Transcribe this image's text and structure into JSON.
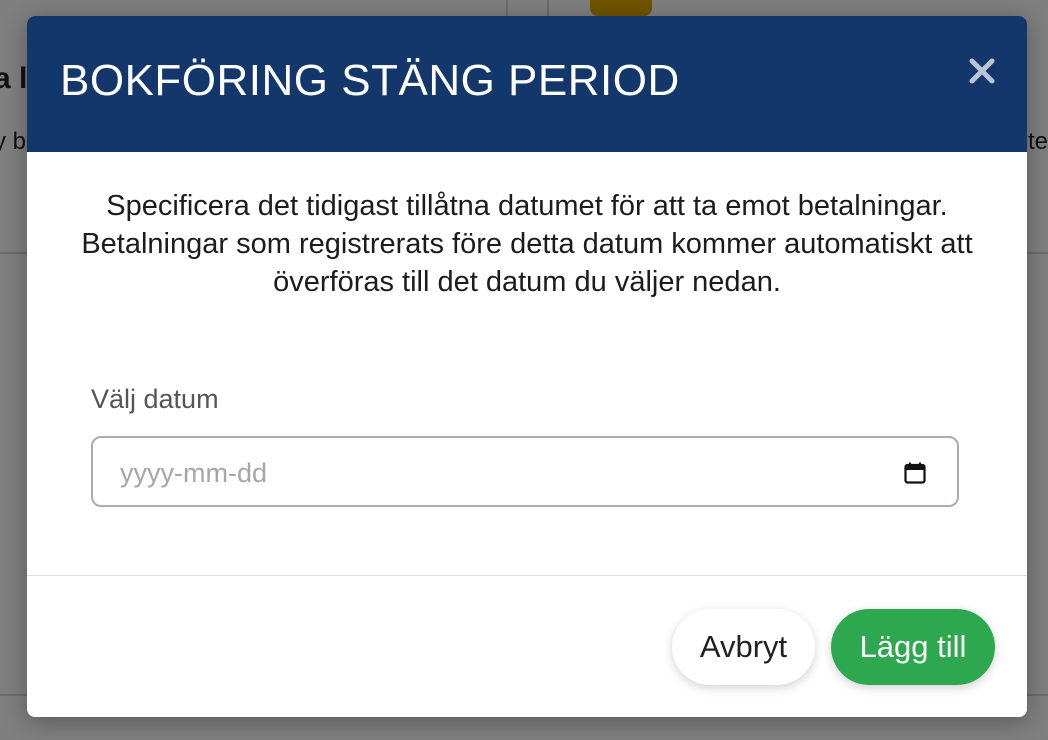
{
  "background": {
    "fragment_left_top": "a l",
    "fragment_left_mid": "y b",
    "fragment_right_mid": "te"
  },
  "modal": {
    "title": "BOKFÖRING STÄNG PERIOD",
    "close_icon": "close-icon",
    "description": "Specificera det tidigast tillåtna datumet för att ta emot betalningar. Betalningar som registrerats före detta datum kommer automatiskt att överföras till det datum du väljer nedan.",
    "date_field": {
      "label": "Välj datum",
      "placeholder": "yyyy-mm-dd",
      "value": "",
      "icon": "calendar-icon"
    },
    "buttons": {
      "cancel_label": "Avbryt",
      "add_label": "Lägg till"
    }
  },
  "colors": {
    "header": "#14376b",
    "primary_button": "#2ea84f",
    "badge": "#e0a800"
  }
}
